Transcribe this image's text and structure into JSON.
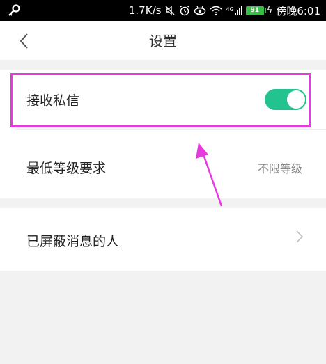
{
  "status_bar": {
    "network_speed": "1.7K/s",
    "signal_tag": "4G",
    "battery_level": "91",
    "time": "傍晚6:01"
  },
  "nav": {
    "title": "设置"
  },
  "settings": {
    "receive_messages": {
      "label": "接收私信",
      "enabled": true
    },
    "min_level": {
      "label": "最低等级要求",
      "value": "不限等级"
    },
    "blocked_users": {
      "label": "已屏蔽消息的人"
    }
  },
  "colors": {
    "toggle_on": "#22c38f",
    "highlight": "#e63adf",
    "section_gap": "#f2f2f2"
  }
}
